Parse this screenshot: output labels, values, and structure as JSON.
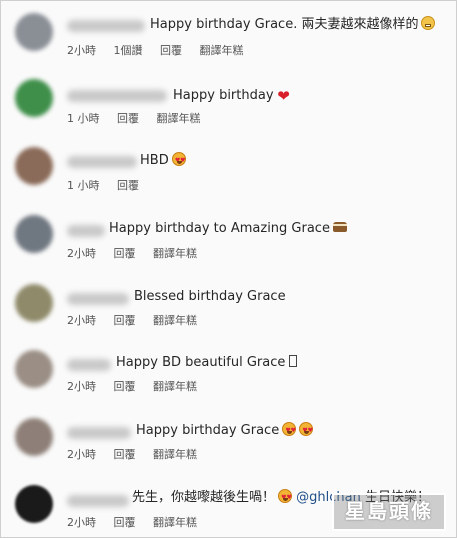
{
  "comments": [
    {
      "text": "Happy birthday Grace. 兩夫妻越來越像样的",
      "emoji": "grimace-emoji",
      "time": "2小時",
      "likes": "1個讚",
      "reply": "回覆",
      "translate": "翻譯年糕",
      "avatar_color": "#8a8f96"
    },
    {
      "text": "Happy birthday",
      "emoji": "heart-emoji",
      "heart": "❤",
      "time": "1 小時",
      "reply": "回覆",
      "translate": "翻譯年糕",
      "avatar_color": "#3f8f4a"
    },
    {
      "text": "HBD",
      "emoji": "heart-eyes-emoji",
      "time": "1 小時",
      "reply": "回覆",
      "avatar_color": "#8a6a58"
    },
    {
      "text": "Happy birthday to Amazing Grace",
      "emoji": "cake-emoji",
      "time": "2小時",
      "reply": "回覆",
      "translate": "翻譯年糕",
      "avatar_color": "#6f7780"
    },
    {
      "text": "Blessed birthday Grace",
      "time": "2小時",
      "reply": "回覆",
      "translate": "翻譯年糕",
      "avatar_color": "#8f8a6a"
    },
    {
      "text": "Happy BD beautiful Grace",
      "emoji": "missing-glyph-box",
      "time": "2小時",
      "reply": "回覆",
      "translate": "翻譯年糕",
      "avatar_color": "#9a8e85"
    },
    {
      "text": "Happy birthday Grace",
      "emoji": "heart-eyes-emoji",
      "time": "2小時",
      "reply": "回覆",
      "translate": "翻譯年糕",
      "avatar_color": "#8e8078"
    },
    {
      "text": "先生，你越嚟越後生喎！",
      "emoji": "heart-eyes-emoji",
      "mention": "@ghlchan",
      "text_after": "生日快樂！",
      "time": "2小時",
      "reply": "回覆",
      "translate": "翻譯年糕",
      "avatar_color": "#1a1a1a"
    }
  ],
  "watermark": "星島頭條"
}
